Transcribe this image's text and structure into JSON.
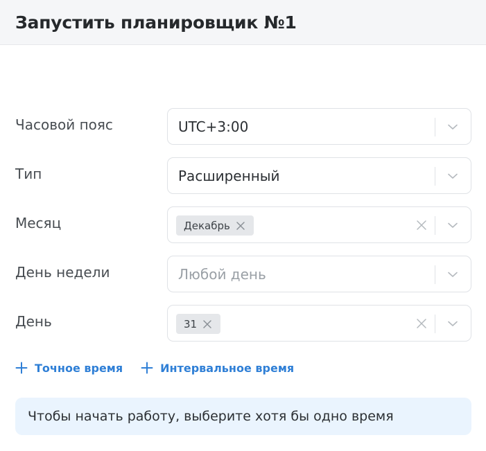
{
  "header": {
    "title": "Запустить планировщик №1"
  },
  "fields": {
    "timezone": {
      "label": "Часовой пояс",
      "value": "UTC+3:00"
    },
    "type": {
      "label": "Тип",
      "value": "Расширенный"
    },
    "month": {
      "label": "Месяц",
      "tags": [
        "Декабрь"
      ]
    },
    "weekday": {
      "label": "День недели",
      "placeholder": "Любой день"
    },
    "day": {
      "label": "День",
      "tags": [
        "31"
      ]
    }
  },
  "actions": {
    "exact_time": "Точное время",
    "interval_time": "Интервальное время"
  },
  "notice": {
    "text": "Чтобы начать работу, выберите хотя бы одно время"
  },
  "colors": {
    "accent": "#2f7fd6",
    "notice_bg": "#eaf4fe",
    "tag_bg": "#e5e7ea",
    "header_bg": "#f5f6f8"
  }
}
